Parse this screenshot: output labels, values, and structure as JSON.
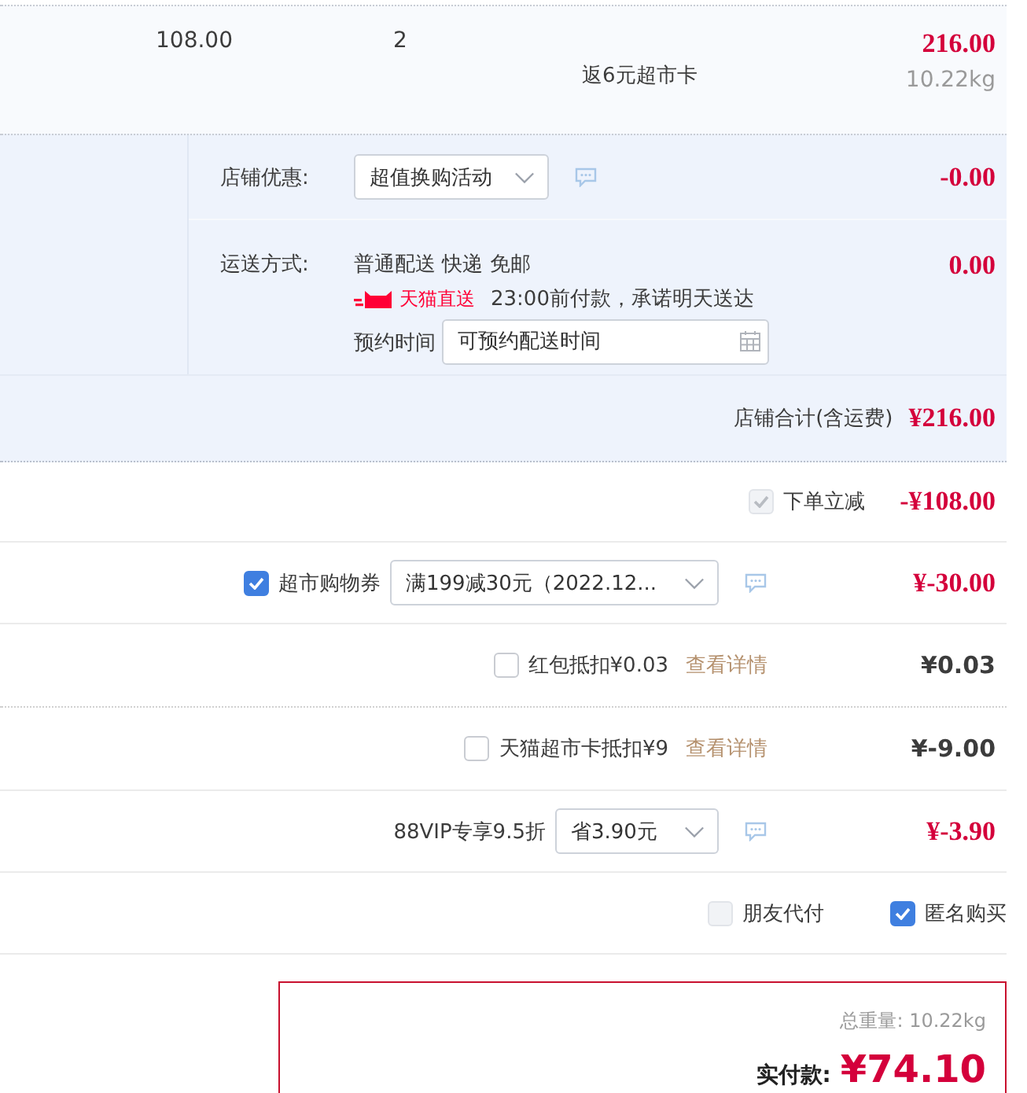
{
  "item": {
    "price": "108.00",
    "quantity": "2",
    "promo": "返6元超市卡",
    "subtotal": "216.00",
    "weight": "10.22kg"
  },
  "store": {
    "discount": {
      "label": "店铺优惠:",
      "selected_option": "超值换购活动",
      "amount": "-0.00"
    },
    "shipping": {
      "label": "运送方式:",
      "method": "普通配送 快递 免邮",
      "badge": "天猫直送",
      "promise": "23:00前付款，承诺明天送达",
      "appointment": {
        "label": "预约时间",
        "placeholder": "可预约配送时间"
      },
      "amount": "0.00"
    },
    "total": {
      "label": "店铺合计(含运费)",
      "amount": "¥216.00"
    }
  },
  "adjustments": [
    {
      "kind": "instant",
      "checked": true,
      "disabled": true,
      "label": "下单立减",
      "amount": "-¥108.00",
      "applied": true
    },
    {
      "kind": "coupon",
      "checked": true,
      "disabled": false,
      "label": "超市购物券",
      "selected_option": "满199减30元（2022.12...",
      "amount": "¥-30.00",
      "applied": true
    },
    {
      "kind": "checkbox",
      "checked": false,
      "disabled": false,
      "label": "红包抵扣¥0.03",
      "link": "查看详情",
      "amount": "¥0.03",
      "applied": false
    },
    {
      "kind": "checkbox",
      "checked": false,
      "disabled": false,
      "label": "天猫超市卡抵扣¥9",
      "link": "查看详情",
      "amount": "¥-9.00",
      "applied": false
    },
    {
      "kind": "select",
      "label": "88VIP专享9.5折",
      "selected_option": "省3.90元",
      "amount": "¥-3.90",
      "applied": true
    }
  ],
  "options": [
    {
      "label": "朋友代付",
      "checked": false,
      "disabled": true
    },
    {
      "label": "匿名购买",
      "checked": true,
      "disabled": false
    }
  ],
  "payment": {
    "weight": "总重量: 10.22kg",
    "label": "实付款:",
    "amount": "¥74.10"
  }
}
